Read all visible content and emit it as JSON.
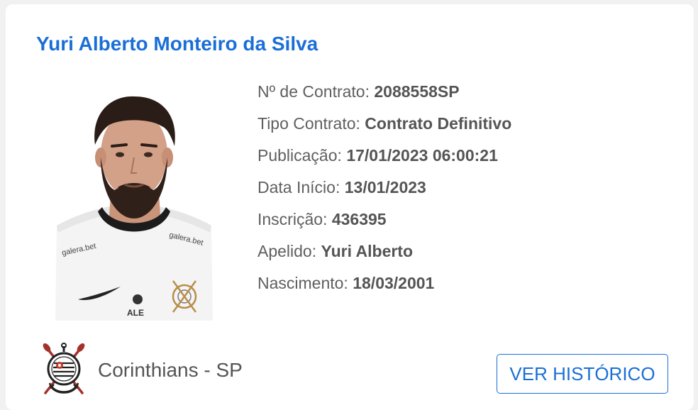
{
  "player": {
    "name": "Yuri Alberto Monteiro da Silva",
    "photo_alt": "Yuri Alberto"
  },
  "details": [
    {
      "label": "Nº de Contrato:",
      "value": "2088558SP"
    },
    {
      "label": "Tipo Contrato:",
      "value": "Contrato Definitivo"
    },
    {
      "label": "Publicação:",
      "value": "17/01/2023 06:00:21"
    },
    {
      "label": "Data Início:",
      "value": "13/01/2023"
    },
    {
      "label": "Inscrição:",
      "value": "436395"
    },
    {
      "label": "Apelido:",
      "value": "Yuri Alberto"
    },
    {
      "label": "Nascimento:",
      "value": "18/03/2001"
    }
  ],
  "jersey_text": {
    "sponsor_left": "galera.bet",
    "sponsor_right": "galera.bet",
    "ale": "ALE"
  },
  "club": {
    "name": "Corinthians - SP",
    "logo_icon": "corinthians-crest-icon"
  },
  "actions": {
    "history_label": "VER HISTÓRICO"
  },
  "colors": {
    "accent": "#1a6fd6",
    "label_text": "#5f5f5f",
    "value_text": "#555555",
    "card_background": "#ffffff",
    "page_background": "#f1f1f1"
  }
}
